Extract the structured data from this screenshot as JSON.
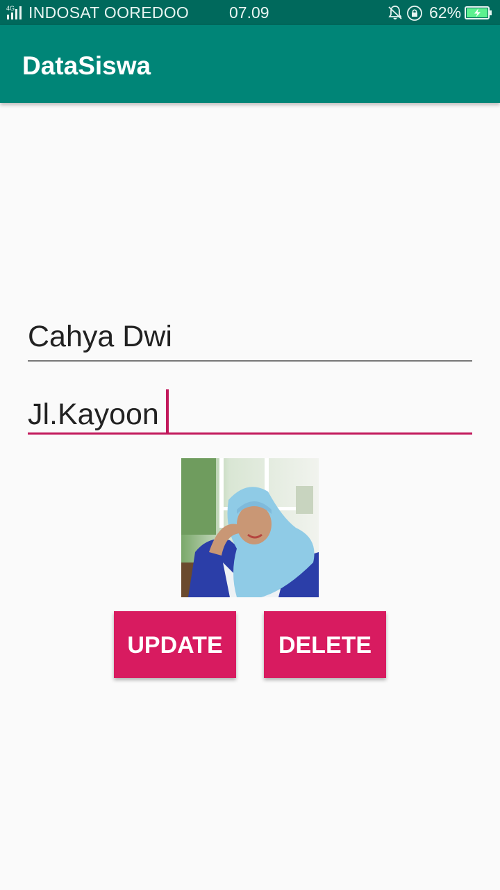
{
  "status_bar": {
    "network_type": "4G",
    "carrier": "INDOSAT OOREDOO",
    "time": "07.09",
    "battery_percent": "62%",
    "icons": [
      "signal-icon",
      "bell-off-icon",
      "rotation-lock-icon",
      "battery-charging-icon"
    ]
  },
  "app_bar": {
    "title": "DataSiswa"
  },
  "form": {
    "name_value": "Cahya Dwi",
    "address_value": "Jl.Kayoon",
    "photo_alt": "student photo"
  },
  "buttons": {
    "update_label": "UPDATE",
    "delete_label": "DELETE"
  },
  "colors": {
    "status_bar": "#00695c",
    "app_bar": "#008577",
    "accent": "#d81b60",
    "focus_line": "#c2185b",
    "background": "#fafafa"
  }
}
